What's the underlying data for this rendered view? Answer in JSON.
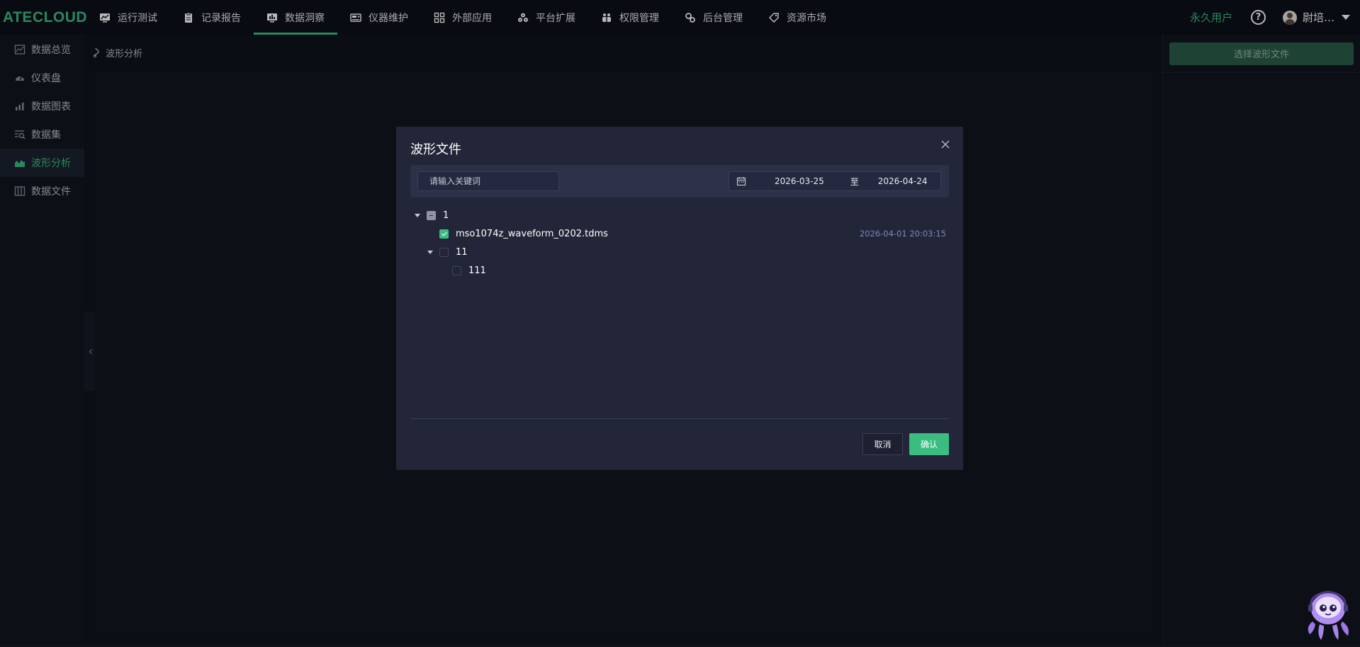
{
  "app": {
    "logo": "ATECLOUD"
  },
  "nav": {
    "items": [
      {
        "label": "运行测试",
        "icon": "monitor-chart-icon",
        "active": false
      },
      {
        "label": "记录报告",
        "icon": "clipboard-icon",
        "active": false
      },
      {
        "label": "数据洞察",
        "icon": "screen-analytics-icon",
        "active": true
      },
      {
        "label": "仪器维护",
        "icon": "instrument-icon",
        "active": false
      },
      {
        "label": "外部应用",
        "icon": "grid-apps-icon",
        "active": false
      },
      {
        "label": "平台扩展",
        "icon": "cubes-icon",
        "active": false
      },
      {
        "label": "权限管理",
        "icon": "shield-people-icon",
        "active": false
      },
      {
        "label": "后台管理",
        "icon": "gears-icon",
        "active": false
      },
      {
        "label": "资源市场",
        "icon": "tag-icon",
        "active": false
      }
    ]
  },
  "user": {
    "tier": "永久用户",
    "name": "尉培…"
  },
  "sidebar": {
    "items": [
      {
        "label": "数据总览",
        "icon": "overview-chart-icon",
        "active": false
      },
      {
        "label": "仪表盘",
        "icon": "gauge-icon",
        "active": false
      },
      {
        "label": "数据图表",
        "icon": "bar-chart-icon",
        "active": false
      },
      {
        "label": "数据集",
        "icon": "dataset-search-icon",
        "active": false
      },
      {
        "label": "波形分析",
        "icon": "waveform-icon",
        "active": true
      },
      {
        "label": "数据文件",
        "icon": "files-icon",
        "active": false
      }
    ]
  },
  "breadcrumb": {
    "label": "波形分析"
  },
  "right_panel": {
    "select_button": "选择波形文件"
  },
  "modal": {
    "title": "波形文件",
    "search_placeholder": "请输入关键词",
    "date_start": "2026-03-25",
    "date_separator": "至",
    "date_end": "2026-04-24",
    "tree": [
      {
        "label": "1",
        "level": 0,
        "expandable": true,
        "state": "indeterminate",
        "date": ""
      },
      {
        "label": "mso1074z_waveform_0202.tdms",
        "level": 1,
        "expandable": false,
        "state": "checked",
        "date": "2026-04-01 20:03:15"
      },
      {
        "label": "11",
        "level": 1,
        "expandable": true,
        "state": "unchecked",
        "date": ""
      },
      {
        "label": "111",
        "level": 2,
        "expandable": false,
        "state": "unchecked",
        "date": ""
      }
    ],
    "cancel_label": "取消",
    "ok_label": "确认"
  },
  "colors": {
    "accent": "#3bbd82",
    "background": "#11141e",
    "modal": "#232639"
  }
}
